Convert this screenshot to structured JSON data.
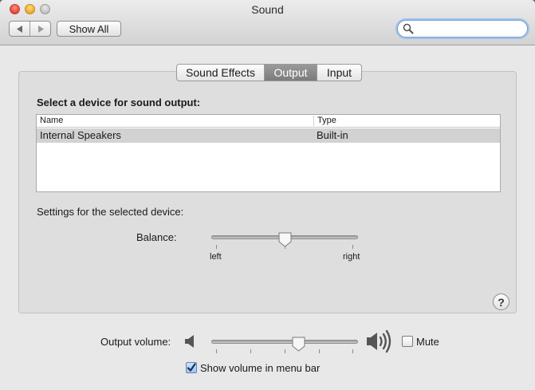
{
  "window": {
    "title": "Sound",
    "buttons": [
      "close",
      "minimize",
      "zoom"
    ]
  },
  "toolbar": {
    "back_icon": "back-arrow-icon",
    "forward_icon": "forward-arrow-icon",
    "show_all_label": "Show All",
    "search": {
      "value": "",
      "placeholder": "",
      "icon": "magnifier-icon"
    }
  },
  "tabs": [
    {
      "label": "Sound Effects",
      "active": false
    },
    {
      "label": "Output",
      "active": true
    },
    {
      "label": "Input",
      "active": false
    }
  ],
  "output_pane": {
    "heading": "Select a device for sound output:",
    "columns": [
      "Name",
      "Type"
    ],
    "devices": [
      {
        "name": "Internal Speakers",
        "type": "Built-in",
        "selected": true
      }
    ],
    "settings_label": "Settings for the selected device:",
    "balance": {
      "label": "Balance:",
      "left_label": "left",
      "right_label": "right",
      "value": 0.5
    }
  },
  "help_label": "?",
  "volume": {
    "label": "Output volume:",
    "value": 0.6,
    "mute_label": "Mute",
    "mute_checked": false,
    "show_in_menubar_label": "Show volume in menu bar",
    "show_in_menubar_checked": true
  },
  "colors": {
    "accent": "#5b87c0",
    "selected_row": "#d2d2d2",
    "active_tab": "#8a8a8a"
  }
}
